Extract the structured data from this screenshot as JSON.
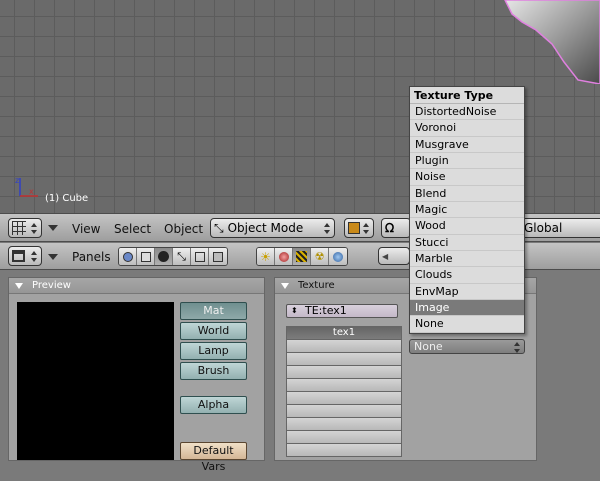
{
  "viewport": {
    "object_label": "(1) Cube"
  },
  "header3d": {
    "menus": [
      "View",
      "Select",
      "Object"
    ],
    "mode_select": "Object Mode",
    "orientation": "Global"
  },
  "buttons_header": {
    "panels_label": "Panels"
  },
  "preview_panel": {
    "title": "Preview",
    "buttons": [
      "Mat",
      "World",
      "Lamp",
      "Brush"
    ],
    "active_button": "Mat",
    "alpha_label": "Alpha",
    "default_vars_label": "Default Vars"
  },
  "texture_panel": {
    "title": "Texture",
    "texture_field": "TE:tex1",
    "slot_label": "tex1",
    "type_select": "None"
  },
  "texture_menu": {
    "title": "Texture Type",
    "items": [
      "DistortedNoise",
      "Voronoi",
      "Musgrave",
      "Plugin",
      "Noise",
      "Blend",
      "Magic",
      "Wood",
      "Stucci",
      "Marble",
      "Clouds",
      "EnvMap",
      "Image",
      "None"
    ],
    "highlighted": "Image"
  },
  "colors": {
    "viewport_bg": "#6a6a6a",
    "grid_line": "#5c5c5c",
    "menu_highlight": "#7a7a7a"
  }
}
